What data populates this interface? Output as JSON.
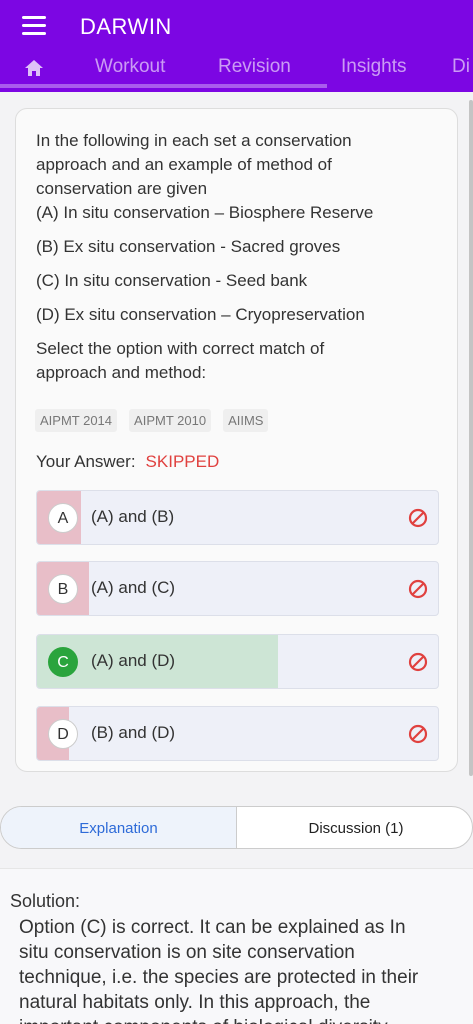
{
  "app": {
    "title": "DARWIN"
  },
  "tabs": [
    {
      "label": "Workout"
    },
    {
      "label": "Revision"
    },
    {
      "label": "Insights"
    },
    {
      "label": "Di"
    }
  ],
  "question": {
    "lines": [
      "In the following in each set a conservation",
      "approach and an example of method of",
      "conservation are given",
      "(A) In situ conservation – Biosphere Reserve",
      "(B) Ex situ conservation - Sacred groves",
      "(C) In situ conservation - Seed bank",
      "(D) Ex situ conservation – Cryopreservation",
      "Select the option with correct match of",
      "approach and method:"
    ],
    "tags": [
      "AIPMT 2014",
      "AIPMT 2010",
      "AIIMS"
    ],
    "your_answer_label": "Your Answer:",
    "your_answer_value": "SKIPPED"
  },
  "options": [
    {
      "letter": "A",
      "text": "(A) and (B)",
      "correct": false,
      "share": 0.11
    },
    {
      "letter": "B",
      "text": "(A) and (C)",
      "correct": false,
      "share": 0.13
    },
    {
      "letter": "C",
      "text": "(A) and (D)",
      "correct": true,
      "share": 0.6
    },
    {
      "letter": "D",
      "text": "(B) and (D)",
      "correct": false,
      "share": 0.08
    }
  ],
  "colors": {
    "primary": "#7c06e3",
    "wrong_fill": "#e8bec8",
    "correct_fill": "#cde5d5",
    "correct_badge": "#2aa43d",
    "skipped": "#e0413f",
    "ban_icon": "#e0413f"
  },
  "segment": {
    "explanation": "Explanation",
    "discussion": "Discussion (1)"
  },
  "solution": {
    "title": "Solution:",
    "lines": [
      "Option (C) is correct. It can be explained as In",
      "situ conservation is on site conservation",
      "technique, i.e. the species are protected in their",
      "natural habitats only. In this approach, the",
      "important components of biological diversity"
    ]
  }
}
